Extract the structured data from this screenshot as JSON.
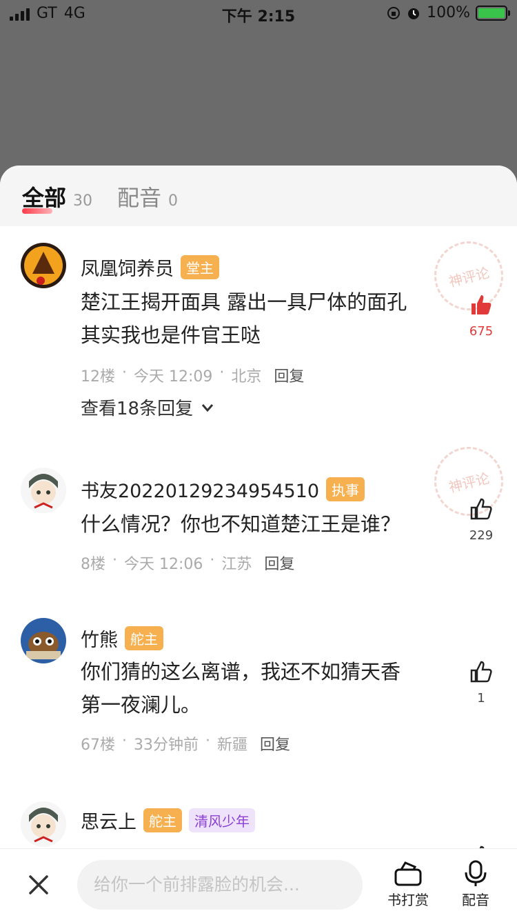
{
  "status_bar": {
    "carrier": "GT",
    "network": "4G",
    "time": "下午 2:15",
    "battery": "100%"
  },
  "tabs": [
    {
      "label": "全部",
      "count": "30"
    },
    {
      "label": "配音",
      "count": "0"
    }
  ],
  "comments": [
    {
      "username": "凤凰饲养员",
      "badges": [
        "堂主"
      ],
      "lines": [
        "楚江王揭开面具 露出一具尸体的面孔",
        "其实我也是件官王哒"
      ],
      "floor": "12楼",
      "time": "今天 12:09",
      "location": "北京",
      "reply_label": "回复",
      "view_replies": "查看18条回复",
      "likes": "675",
      "stamp": "神评论"
    },
    {
      "username": "书友20220129234954510",
      "badges": [
        "执事"
      ],
      "lines": [
        "什么情况？你也不知道楚江王是谁？"
      ],
      "floor": "8楼",
      "time": "今天 12:06",
      "location": "江苏",
      "reply_label": "回复",
      "likes": "229",
      "stamp": "神评论"
    },
    {
      "username": "竹熊",
      "badges": [
        "舵主"
      ],
      "lines": [
        "你们猜的这么离谱，我还不如猜天香",
        "第一夜澜儿。"
      ],
      "floor": "67楼",
      "time": "33分钟前",
      "location": "新疆",
      "reply_label": "回复",
      "likes": "1"
    },
    {
      "username": "思云上",
      "badges": [
        "舵主",
        "清风少年"
      ],
      "lines": []
    }
  ],
  "bottom_bar": {
    "input_placeholder": "给你一个前排露脸的机会...",
    "tip_label": "书打赏",
    "dub_label": "配音"
  }
}
